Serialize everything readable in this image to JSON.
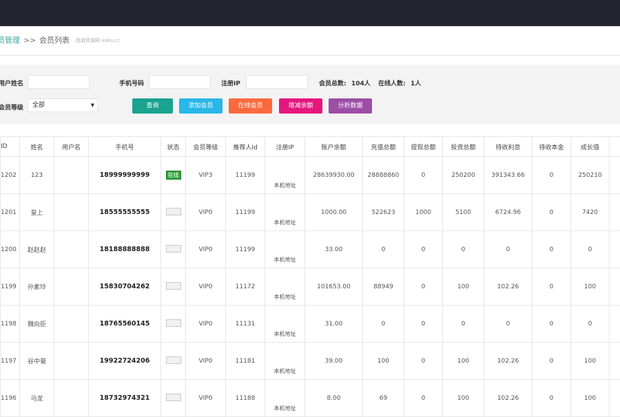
{
  "breadcrumb": {
    "parent": "员管理",
    "separator": ">>",
    "current": "会员列表",
    "watermark": "西游资源网 xxku.cc"
  },
  "filters": {
    "username_label": "用户姓名",
    "phone_label": "手机号码",
    "ip_label": "注册IP",
    "level_label": "会员等级",
    "level_value": "全部"
  },
  "stats": {
    "total_label": "会员总数:",
    "total_value": "104人",
    "online_label": "在线人数:",
    "online_value": "1人"
  },
  "buttons": {
    "query": "查询",
    "add": "添加会员",
    "online": "在线会员",
    "add_sub_amount": "增减余额",
    "analysis": "分析数据"
  },
  "colors": {
    "query": "#1aa38f",
    "add": "#29b6e8",
    "online": "#fb6a3d",
    "add_sub_amount": "#e5177f",
    "analysis": "#9c4ea6",
    "status_on": "#2ea33b"
  },
  "table": {
    "headers": [
      "ID",
      "姓名",
      "用户名",
      "手机号",
      "状态",
      "会员等级",
      "推荐人Id",
      "注册IP",
      "账户余额",
      "充值总额",
      "提现总额",
      "投资总额",
      "待收利息",
      "待收本金",
      "成长值"
    ],
    "rows": [
      {
        "id": "1202",
        "name": "123",
        "username": "",
        "phone": "18999999999",
        "status": "在线",
        "online": true,
        "level": "VIP3",
        "referrer": "11199",
        "ip": "本机地址",
        "balance": "28639930.00",
        "recharge": "28888860",
        "withdraw": "0",
        "invest": "250200",
        "interest": "391343.66",
        "principal": "0",
        "growth": "250210"
      },
      {
        "id": "1201",
        "name": "皇上",
        "username": "",
        "phone": "18555555555",
        "status": "",
        "online": false,
        "level": "VIP0",
        "referrer": "11199",
        "ip": "本机地址",
        "balance": "1000.00",
        "recharge": "522623",
        "withdraw": "1000",
        "invest": "5100",
        "interest": "6724.96",
        "principal": "0",
        "growth": "7420"
      },
      {
        "id": "1200",
        "name": "赵赵赵",
        "username": "",
        "phone": "18188888888",
        "status": "",
        "online": false,
        "level": "VIP0",
        "referrer": "11199",
        "ip": "本机地址",
        "balance": "33.00",
        "recharge": "0",
        "withdraw": "0",
        "invest": "0",
        "interest": "0",
        "principal": "0",
        "growth": "0"
      },
      {
        "id": "1199",
        "name": "孙素玲",
        "username": "",
        "phone": "15830704262",
        "status": "",
        "online": false,
        "level": "VIP0",
        "referrer": "11172",
        "ip": "本机地址",
        "balance": "101653.00",
        "recharge": "88949",
        "withdraw": "0",
        "invest": "100",
        "interest": "102.26",
        "principal": "0",
        "growth": "100"
      },
      {
        "id": "1198",
        "name": "魏向臣",
        "username": "",
        "phone": "18765560145",
        "status": "",
        "online": false,
        "level": "VIP0",
        "referrer": "11131",
        "ip": "本机地址",
        "balance": "31.00",
        "recharge": "0",
        "withdraw": "0",
        "invest": "0",
        "interest": "0",
        "principal": "0",
        "growth": "0"
      },
      {
        "id": "1197",
        "name": "谷中菊",
        "username": "",
        "phone": "19922724206",
        "status": "",
        "online": false,
        "level": "VIP0",
        "referrer": "11181",
        "ip": "本机地址",
        "balance": "39.00",
        "recharge": "100",
        "withdraw": "0",
        "invest": "100",
        "interest": "102.26",
        "principal": "0",
        "growth": "100"
      },
      {
        "id": "1196",
        "name": "马龙",
        "username": "",
        "phone": "18732974321",
        "status": "",
        "online": false,
        "level": "VIP0",
        "referrer": "11188",
        "ip": "本机地址",
        "balance": "8.00",
        "recharge": "69",
        "withdraw": "0",
        "invest": "100",
        "interest": "102.26",
        "principal": "0",
        "growth": "100"
      }
    ]
  }
}
